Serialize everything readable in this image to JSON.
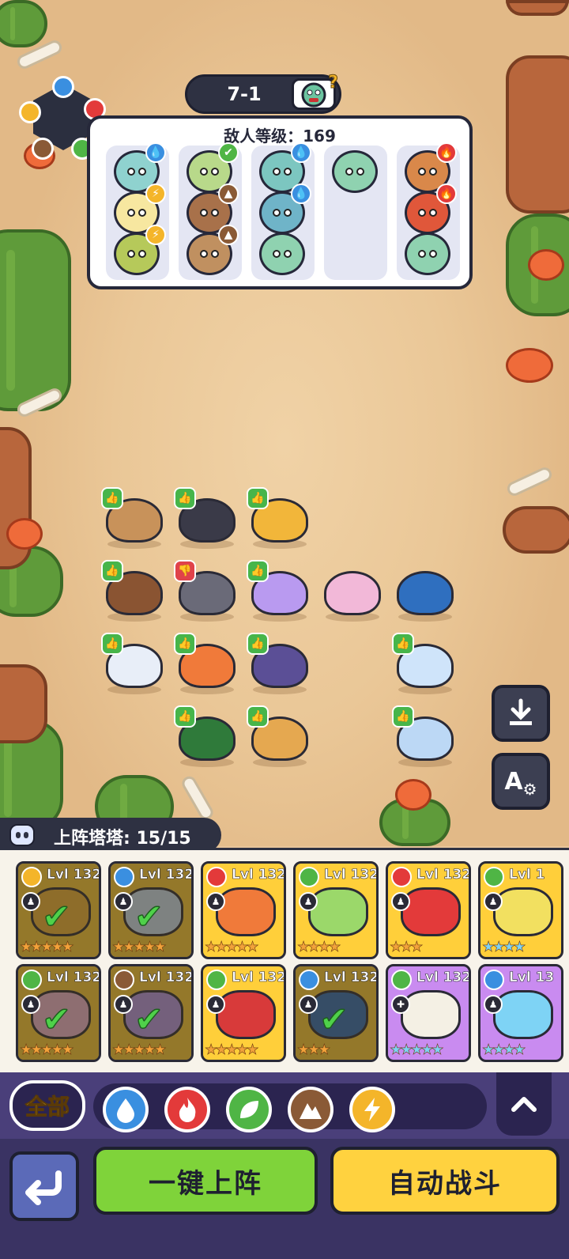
{
  "stage": {
    "label": "7-1"
  },
  "enemy_panel": {
    "title": "敌人等级：169",
    "columns": [
      {
        "mobs": [
          "water",
          "bolt",
          "bolt"
        ]
      },
      {
        "mobs": [
          "leaf",
          "earth",
          "earth"
        ]
      },
      {
        "mobs": [
          "water",
          "water",
          "none"
        ]
      },
      {
        "mobs": [
          "none"
        ]
      },
      {
        "mobs": [
          "fire",
          "fire",
          "none"
        ]
      }
    ]
  },
  "side_buttons": {
    "auto_label": "A"
  },
  "team": {
    "label": "上阵塔塔: 15/15"
  },
  "roster": {
    "row1": [
      {
        "level": "Lvl 132",
        "element": "bolt",
        "deployed": true
      },
      {
        "level": "Lvl 132",
        "element": "water",
        "deployed": true
      },
      {
        "level": "Lvl 132",
        "element": "fire",
        "deployed": false
      },
      {
        "level": "Lvl 132",
        "element": "leaf",
        "deployed": false
      },
      {
        "level": "Lvl 132",
        "element": "fire",
        "deployed": false
      },
      {
        "level": "Lvl 1",
        "element": "leaf",
        "deployed": false
      }
    ],
    "row2": [
      {
        "level": "Lvl 132",
        "element": "leaf",
        "deployed": true
      },
      {
        "level": "Lvl 132",
        "element": "earth",
        "deployed": true
      },
      {
        "level": "Lvl 132",
        "element": "leaf",
        "deployed": false
      },
      {
        "level": "Lvl 132",
        "element": "water",
        "deployed": true
      },
      {
        "level": "Lvl 132",
        "element": "leaf",
        "deployed": false
      },
      {
        "level": "Lvl 13",
        "element": "water",
        "deployed": false
      }
    ]
  },
  "filters": {
    "all_label": "全部",
    "elements": [
      "water",
      "fire",
      "leaf",
      "earth",
      "bolt"
    ]
  },
  "actions": {
    "quick_deploy": "一键上阵",
    "auto_battle": "自动战斗"
  },
  "colors": {
    "water": "#3a8fe0",
    "fire": "#e33a3a",
    "leaf": "#4fb545",
    "earth": "#8a5a36",
    "bolt": "#f4b52a"
  }
}
